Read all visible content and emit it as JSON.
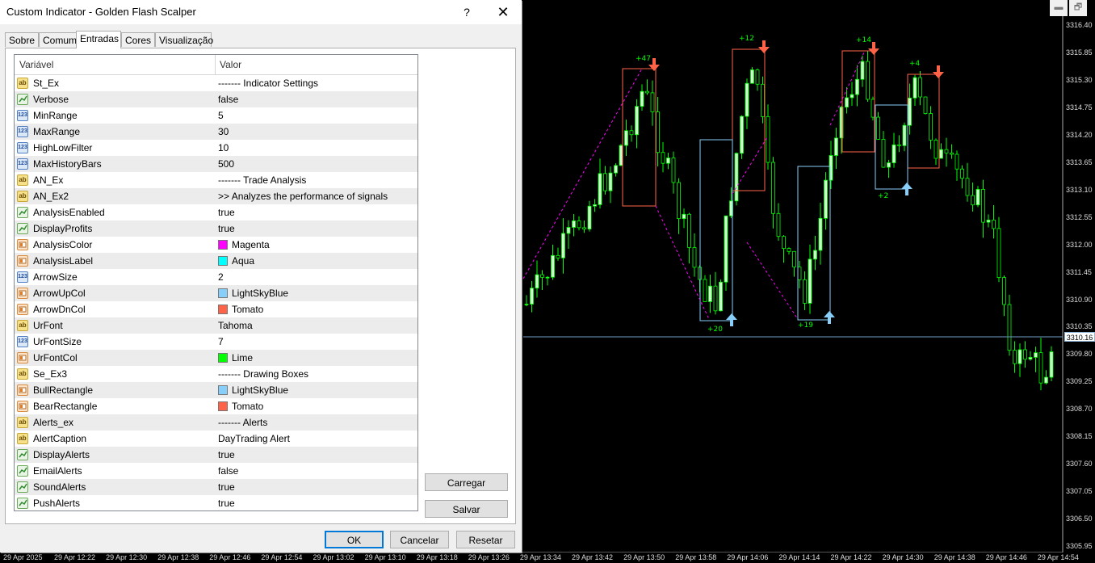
{
  "dialog": {
    "title": "Custom Indicator - Golden Flash Scalper",
    "help_label": "?",
    "close_label": "✕",
    "tabs": [
      {
        "label": "Sobre"
      },
      {
        "label": "Comum"
      },
      {
        "label": "Entradas",
        "active": true
      },
      {
        "label": "Cores"
      },
      {
        "label": "Visualização"
      }
    ],
    "grid": {
      "col_variable": "Variável",
      "col_value": "Valor",
      "rows": [
        {
          "type": "string",
          "name": "St_Ex",
          "value": "------- Indicator Settings"
        },
        {
          "type": "bool",
          "name": "Verbose",
          "value": "false"
        },
        {
          "type": "number",
          "name": "MinRange",
          "value": "5"
        },
        {
          "type": "number",
          "name": "MaxRange",
          "value": "30"
        },
        {
          "type": "number",
          "name": "HighLowFilter",
          "value": "10"
        },
        {
          "type": "number",
          "name": "MaxHistoryBars",
          "value": "500"
        },
        {
          "type": "string",
          "name": "AN_Ex",
          "value": "------- Trade Analysis"
        },
        {
          "type": "string",
          "name": "AN_Ex2",
          "value": ">> Analyzes the performance of signals"
        },
        {
          "type": "bool",
          "name": "AnalysisEnabled",
          "value": "true"
        },
        {
          "type": "bool",
          "name": "DisplayProfits",
          "value": "true"
        },
        {
          "type": "color",
          "name": "AnalysisColor",
          "value": "Magenta",
          "swatch": "#ff00ff"
        },
        {
          "type": "color",
          "name": "AnalysisLabel",
          "value": "Aqua",
          "swatch": "#00ffff"
        },
        {
          "type": "number",
          "name": "ArrowSize",
          "value": "2"
        },
        {
          "type": "color",
          "name": "ArrowUpCol",
          "value": "LightSkyBlue",
          "swatch": "#87cefa"
        },
        {
          "type": "color",
          "name": "ArrowDnCol",
          "value": "Tomato",
          "swatch": "#ff6347"
        },
        {
          "type": "string",
          "name": "UrFont",
          "value": "Tahoma"
        },
        {
          "type": "number",
          "name": "UrFontSize",
          "value": "7"
        },
        {
          "type": "color",
          "name": "UrFontCol",
          "value": "Lime",
          "swatch": "#00ff00"
        },
        {
          "type": "string",
          "name": "Se_Ex3",
          "value": "------- Drawing Boxes"
        },
        {
          "type": "color",
          "name": "BullRectangle",
          "value": "LightSkyBlue",
          "swatch": "#87cefa"
        },
        {
          "type": "color",
          "name": "BearRectangle",
          "value": "Tomato",
          "swatch": "#ff6347"
        },
        {
          "type": "string",
          "name": "Alerts_ex",
          "value": "------- Alerts"
        },
        {
          "type": "string",
          "name": "AlertCaption",
          "value": "DayTrading Alert"
        },
        {
          "type": "bool",
          "name": "DisplayAlerts",
          "value": "true"
        },
        {
          "type": "bool",
          "name": "EmailAlerts",
          "value": "false"
        },
        {
          "type": "bool",
          "name": "SoundAlerts",
          "value": "true"
        },
        {
          "type": "bool",
          "name": "PushAlerts",
          "value": "true"
        }
      ]
    },
    "buttons": {
      "load": "Carregar",
      "save": "Salvar",
      "ok": "OK",
      "cancel": "Cancelar",
      "reset": "Resetar"
    }
  },
  "window_controls": {
    "minimize": "▬",
    "restore": "🗗"
  },
  "chart": {
    "colors": {
      "background": "#000000",
      "bull_candle": "#ccffcc",
      "bear_candle": "#000000",
      "wick": "#00ff00",
      "bull_box": "#87cefa",
      "bear_box": "#ff6347",
      "analysis_line": "#ff00ff",
      "profit_label": "#00ff00",
      "price_line": "#6f9cc4"
    },
    "price_labels": [
      "3316.40",
      "3315.85",
      "3315.30",
      "3314.75",
      "3314.20",
      "3313.65",
      "3313.10",
      "3312.55",
      "3312.00",
      "3311.45",
      "3310.90",
      "3310.35",
      "3309.80",
      "3309.25",
      "3308.70",
      "3308.15",
      "3307.60",
      "3307.05",
      "3306.50",
      "3305.95"
    ],
    "last_price": "3310.16",
    "time_labels": [
      "29 Apr 2025",
      "29 Apr 12:22",
      "29 Apr 12:30",
      "29 Apr 12:38",
      "29 Apr 12:46",
      "29 Apr 12:54",
      "29 Apr 13:02",
      "29 Apr 13:10",
      "29 Apr 13:18",
      "29 Apr 13:26",
      "29 Apr 13:34",
      "29 Apr 13:42",
      "29 Apr 13:50",
      "29 Apr 13:58",
      "29 Apr 14:06",
      "29 Apr 14:14",
      "29 Apr 14:22",
      "29 Apr 14:30",
      "29 Apr 14:38",
      "29 Apr 14:46",
      "29 Apr 14:54"
    ],
    "profit_labels": [
      {
        "text": "+47",
        "dir": "down"
      },
      {
        "text": "+12",
        "dir": "down"
      },
      {
        "text": "+14",
        "dir": "down"
      },
      {
        "text": "+4",
        "dir": "down"
      },
      {
        "text": "+20",
        "dir": "up"
      },
      {
        "text": "+19",
        "dir": "up"
      },
      {
        "text": "+2",
        "dir": "up"
      }
    ]
  }
}
